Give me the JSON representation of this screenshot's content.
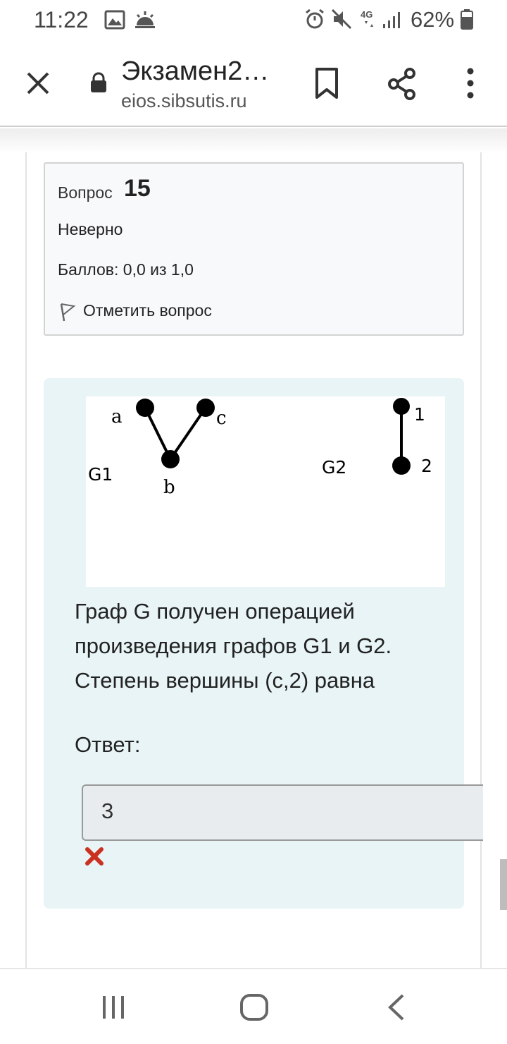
{
  "status_bar": {
    "time": "11:22",
    "battery": "62%",
    "network": "4G"
  },
  "toolbar": {
    "title": "Экзамен2…",
    "url": "eios.sibsutis.ru"
  },
  "question_info": {
    "label": "Вопрос",
    "number": "15",
    "state": "Неверно",
    "grade": "Баллов: 0,0 из 1,0",
    "flag_label": "Отметить вопрос"
  },
  "figure": {
    "g1_label": "G1",
    "g2_label": "G2",
    "vertices_g1": [
      "a",
      "b",
      "c"
    ],
    "vertices_g2": [
      "1",
      "2"
    ]
  },
  "question": {
    "text": "Граф G получен операцией произведения графов G1 и G2. Степень вершины (c,2) равна",
    "answer_label": "Ответ:",
    "answer_value": "3"
  },
  "colors": {
    "content_background": "#e8f4f6",
    "info_background": "#f8f9fa",
    "wrong_mark": "#ca3120"
  }
}
